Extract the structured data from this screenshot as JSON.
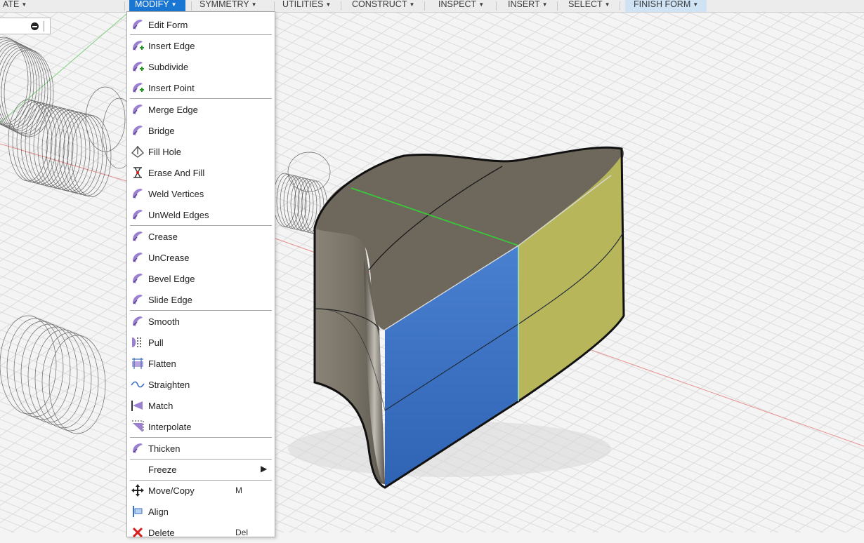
{
  "toolbar": {
    "create_fragment": "ATE",
    "modify": "MODIFY",
    "symmetry": "SYMMETRY",
    "utilities": "UTILITIES",
    "construct": "CONSTRUCT",
    "inspect": "INSPECT",
    "insert": "INSERT",
    "select": "SELECT",
    "finish_form": "FINISH FORM",
    "caret": "▼"
  },
  "menu": {
    "items": [
      {
        "label": "Edit Form",
        "icon": "edit-form-icon"
      },
      {
        "label": "Insert Edge",
        "icon": "insert-edge-icon"
      },
      {
        "label": "Subdivide",
        "icon": "subdivide-icon"
      },
      {
        "label": "Insert Point",
        "icon": "insert-point-icon"
      },
      {
        "label": "Merge Edge",
        "icon": "merge-edge-icon"
      },
      {
        "label": "Bridge",
        "icon": "bridge-icon"
      },
      {
        "label": "Fill Hole",
        "icon": "fill-hole-icon"
      },
      {
        "label": "Erase And Fill",
        "icon": "erase-and-fill-icon"
      },
      {
        "label": "Weld Vertices",
        "icon": "weld-vertices-icon"
      },
      {
        "label": "UnWeld Edges",
        "icon": "unweld-edges-icon"
      },
      {
        "label": "Crease",
        "icon": "crease-icon"
      },
      {
        "label": "UnCrease",
        "icon": "uncrease-icon"
      },
      {
        "label": "Bevel Edge",
        "icon": "bevel-edge-icon"
      },
      {
        "label": "Slide Edge",
        "icon": "slide-edge-icon"
      },
      {
        "label": "Smooth",
        "icon": "smooth-icon"
      },
      {
        "label": "Pull",
        "icon": "pull-icon"
      },
      {
        "label": "Flatten",
        "icon": "flatten-icon"
      },
      {
        "label": "Straighten",
        "icon": "straighten-icon"
      },
      {
        "label": "Match",
        "icon": "match-icon"
      },
      {
        "label": "Interpolate",
        "icon": "interpolate-icon"
      },
      {
        "label": "Thicken",
        "icon": "thicken-icon"
      },
      {
        "label": "Freeze",
        "icon": "freeze-icon",
        "submenu_arrow": "▶"
      },
      {
        "label": "Move/Copy",
        "icon": "move-copy-icon",
        "shortcut": "M"
      },
      {
        "label": "Align",
        "icon": "align-icon"
      },
      {
        "label": "Delete",
        "icon": "delete-icon",
        "shortcut": "Del"
      }
    ]
  },
  "colors": {
    "menu_accent": "#9b7fd0",
    "active_tab": "#1976d2",
    "finish_tab": "#cfe3f5",
    "face_blue": "#3a73c4",
    "face_yellow": "#b9b85a",
    "face_gray": "#6b6559",
    "axis_green": "#37c837",
    "axis_red": "#e07a7a"
  }
}
